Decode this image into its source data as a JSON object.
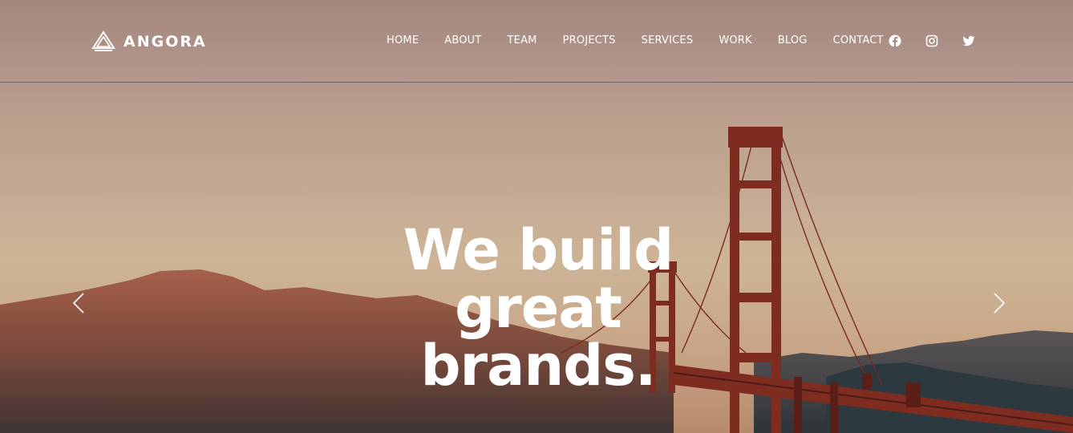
{
  "brand": {
    "name": "ANGORA",
    "logo_icon": "triangle-stack-logo-icon"
  },
  "nav": {
    "items": [
      "HOME",
      "ABOUT",
      "TEAM",
      "PROJECTS",
      "SERVICES",
      "WORK",
      "BLOG",
      "CONTACT"
    ]
  },
  "social": {
    "icons": [
      "facebook-icon",
      "instagram-icon",
      "twitter-icon"
    ]
  },
  "hero": {
    "line1": "We build",
    "line2": "great",
    "line3": "brands."
  },
  "slider": {
    "prev_icon": "chevron-left-icon",
    "next_icon": "chevron-right-icon"
  },
  "colors": {
    "text": "#ffffff",
    "bridge": "#8a2e22",
    "sky_top": "#a88a80",
    "sky_mid": "#cbb296"
  }
}
